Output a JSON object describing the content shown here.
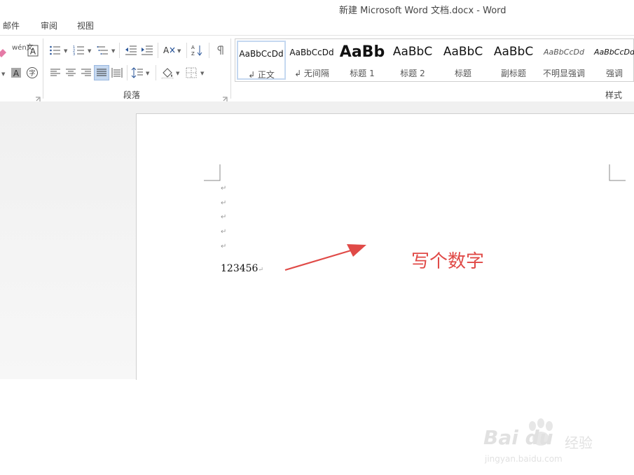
{
  "window": {
    "title": "新建 Microsoft Word 文档.docx - Word"
  },
  "tabs": [
    {
      "label": "邮件"
    },
    {
      "label": "审阅"
    },
    {
      "label": "视图"
    }
  ],
  "ribbon": {
    "paragraph_group_label": "段落",
    "styles_group_label": "样式",
    "phonetic_icon_text": "wén文",
    "border_char": "A",
    "shading_char": "A",
    "enclose_char": "字",
    "sort_icon_text": "A↓Z"
  },
  "styles": [
    {
      "preview": "AaBbCcDd",
      "name": "↲ 正文",
      "selected": true
    },
    {
      "preview": "AaBbCcDd",
      "name": "↲ 无间隔",
      "selected": false
    },
    {
      "preview": "AaBb",
      "name": "标题 1",
      "selected": false
    },
    {
      "preview": "AaBbC",
      "name": "标题 2",
      "selected": false
    },
    {
      "preview": "AaBbC",
      "name": "标题",
      "selected": false
    },
    {
      "preview": "AaBbC",
      "name": "副标题",
      "selected": false
    },
    {
      "preview": "AaBbCcDd",
      "name": "不明显强调",
      "selected": false
    },
    {
      "preview": "AaBbCcDd",
      "name": "强调",
      "selected": false
    }
  ],
  "document": {
    "paragraph_mark": "↵",
    "number_line": "123456",
    "number_mark": "↵"
  },
  "annotation": {
    "text": "写个数字",
    "color": "#e04a47"
  },
  "watermark": {
    "logo": "Bai du",
    "brand": "经验",
    "url": "jingyan.baidu.com"
  },
  "colors": {
    "accent": "#2b579a",
    "selection": "#c5d8f0",
    "annotation": "#e04a47"
  }
}
